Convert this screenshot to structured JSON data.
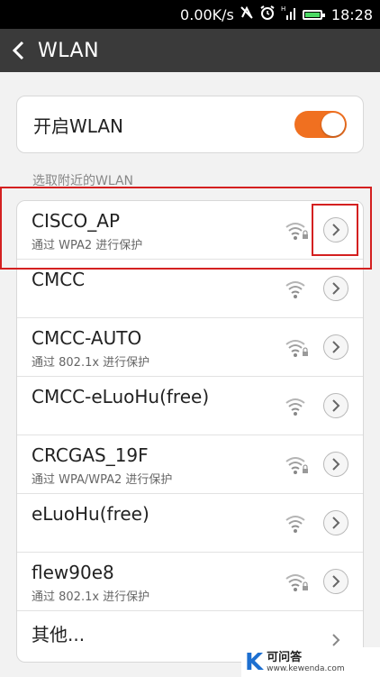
{
  "status_bar": {
    "speed": "0.00K/s",
    "time": "18:28",
    "icons": [
      "no-sync-icon",
      "alarm-icon",
      "signal-icon",
      "battery-icon"
    ],
    "signal_label": "H"
  },
  "title_bar": {
    "title": "WLAN",
    "back_icon": "back-arrow-icon"
  },
  "wlan_toggle": {
    "label": "开启WLAN",
    "on": true,
    "color": "#f07020"
  },
  "section_label": "选取附近的WLAN",
  "networks": [
    {
      "name": "CISCO_AP",
      "subtitle": "通过 WPA2 进行保护",
      "secured": true
    },
    {
      "name": "CMCC",
      "subtitle": "",
      "secured": false
    },
    {
      "name": "CMCC-AUTO",
      "subtitle": "通过 802.1x 进行保护",
      "secured": true
    },
    {
      "name": "CMCC-eLuoHu(free)",
      "subtitle": "",
      "secured": false
    },
    {
      "name": "CRCGAS_19F",
      "subtitle": "通过 WPA/WPA2 进行保护",
      "secured": true
    },
    {
      "name": "eLuoHu(free)",
      "subtitle": "",
      "secured": false
    },
    {
      "name": "flew90e8",
      "subtitle": "通过 802.1x 进行保护",
      "secured": true
    }
  ],
  "other": {
    "label": "其他..."
  },
  "highlight_color": "#d42020",
  "watermark": {
    "logo": "K",
    "title": "可问答",
    "url": "www.kewenda.com"
  }
}
